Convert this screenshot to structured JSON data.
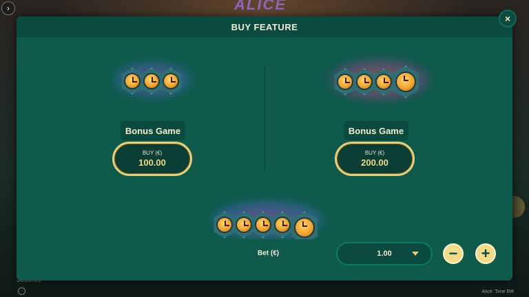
{
  "header": {
    "title": "BUY FEATURE",
    "close_label": "×"
  },
  "features": [
    {
      "name": "Bonus Game",
      "buy_label": "BUY (€)",
      "price": "100.00",
      "clocks": 3
    },
    {
      "name": "Bonus Game",
      "buy_label": "BUY (€)",
      "price": "200.00",
      "clocks": 4
    },
    {
      "clocks": 5
    }
  ],
  "bet": {
    "label": "Bet (€)",
    "value": "1.00",
    "decrease_label": "−",
    "increase_label": "+"
  },
  "background": {
    "logo_text": "ALICE",
    "balance": "3000.00",
    "game_name": "Alice: Time Rift"
  },
  "colors": {
    "panel": "#0e5a4b",
    "header": "#0b4a3e",
    "accent_gold": "#e8cf7a",
    "text_light": "#f3ead4"
  },
  "icons": {
    "corner_arrow": "chevron-right-icon",
    "close": "close-icon",
    "minus": "minus-icon",
    "plus": "plus-icon",
    "feature_art": "clock-icon"
  }
}
